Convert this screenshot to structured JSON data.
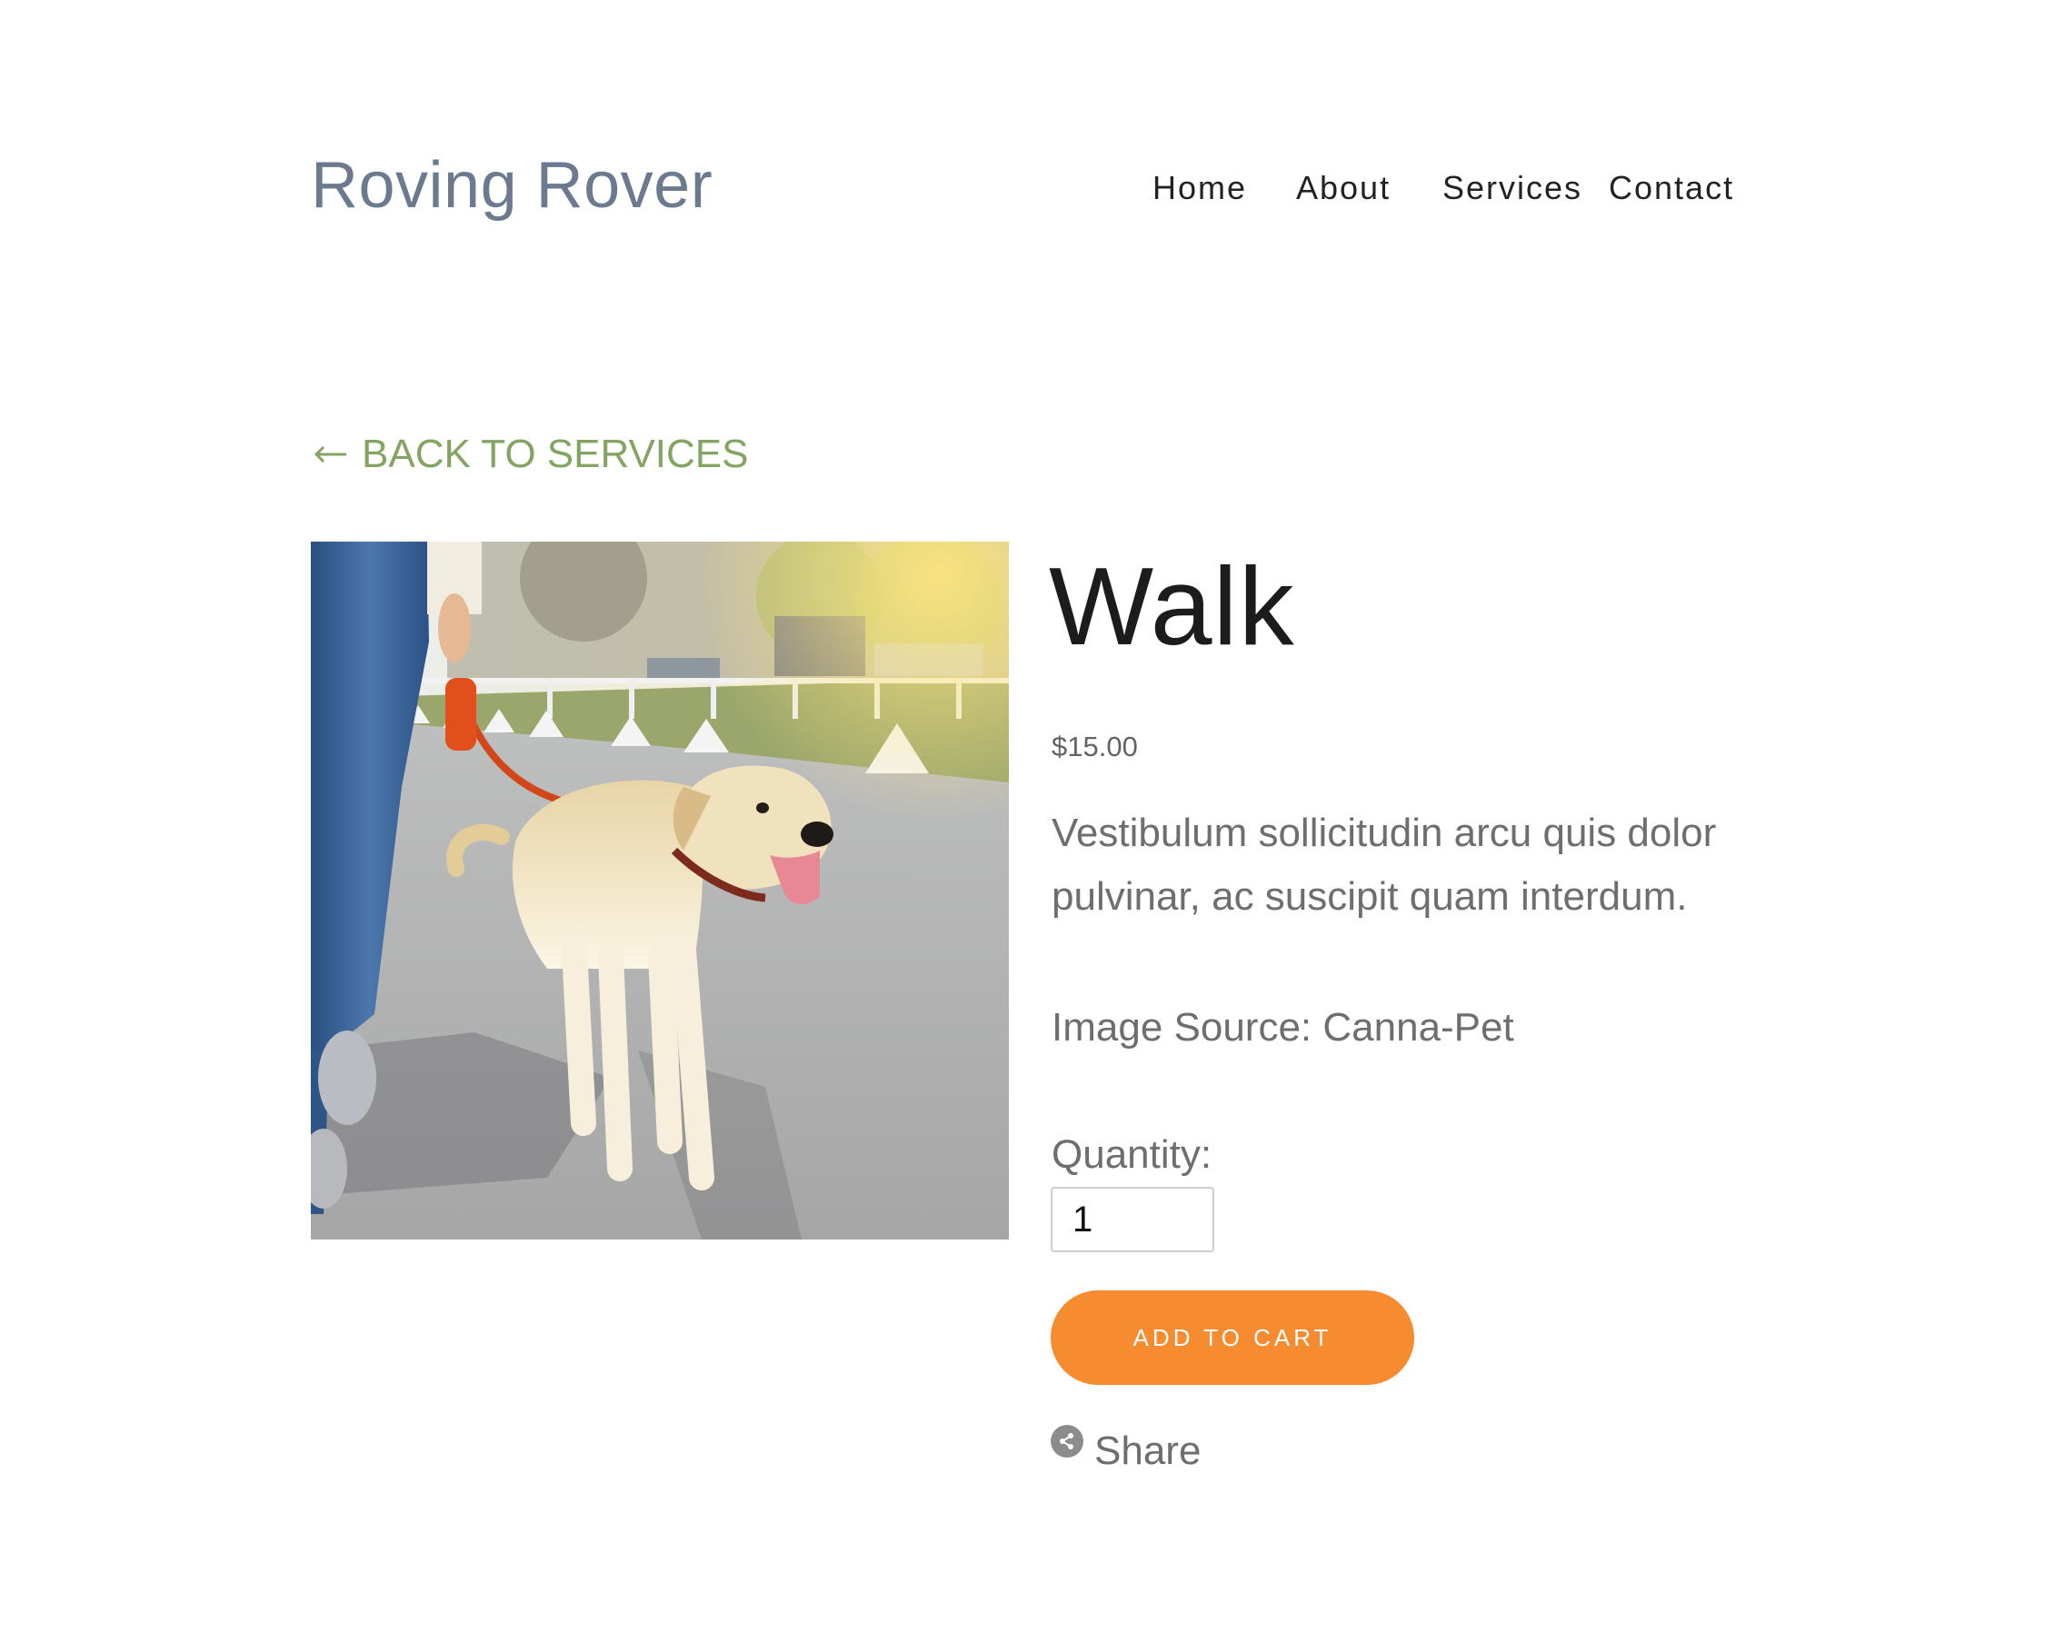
{
  "header": {
    "site_title": "Roving Rover",
    "nav": [
      {
        "label": "Home"
      },
      {
        "label": "About"
      },
      {
        "label": "Services"
      },
      {
        "label": "Contact"
      }
    ]
  },
  "back_link": {
    "label": "BACK TO SERVICES",
    "icon": "left-arrow-icon"
  },
  "product": {
    "image_alt": "Person walking a yellow Labrador on a leash",
    "name": "Walk",
    "price": "$15.00",
    "description": "Vestibulum sollicitudin arcu quis dolor pulvinar, ac suscipit quam interdum.",
    "image_source": "Image Source: Canna-Pet",
    "quantity_label": "Quantity:",
    "quantity_value": "1",
    "add_to_cart_label": "ADD TO CART",
    "share_label": "Share",
    "share_icon": "share-icon"
  },
  "colors": {
    "accent_orange": "#f68b2f",
    "link_green": "#84a462",
    "title_slate": "#6b7a8f"
  }
}
